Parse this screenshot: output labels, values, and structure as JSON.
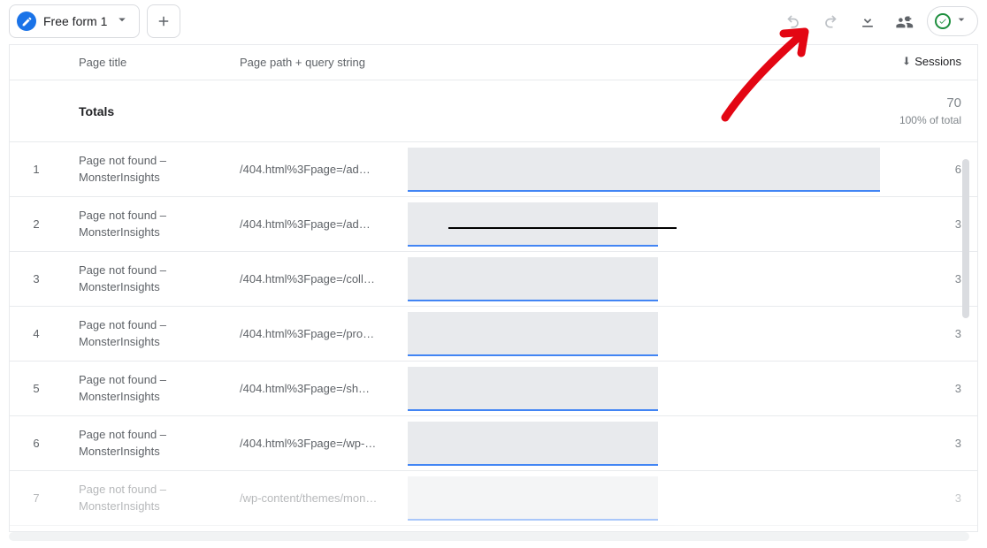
{
  "toolbar": {
    "tab_label": "Free form 1"
  },
  "columns": {
    "page_title": "Page title",
    "page_path": "Page path + query string",
    "sessions": "Sessions"
  },
  "totals": {
    "label": "Totals",
    "value": "70",
    "sub": "100% of total"
  },
  "rows": [
    {
      "n": "1",
      "title": "Page not found – MonsterInsights",
      "path": "/404.html%3Fpage=/ad…",
      "sessions": "6",
      "bar_pct": 100,
      "fade": false
    },
    {
      "n": "2",
      "title": "Page not found – MonsterInsights",
      "path": "/404.html%3Fpage=/ad…",
      "sessions": "3",
      "bar_pct": 53,
      "fade": false,
      "blackline": true
    },
    {
      "n": "3",
      "title": "Page not found – MonsterInsights",
      "path": "/404.html%3Fpage=/coll…",
      "sessions": "3",
      "bar_pct": 53,
      "fade": false
    },
    {
      "n": "4",
      "title": "Page not found – MonsterInsights",
      "path": "/404.html%3Fpage=/pro…",
      "sessions": "3",
      "bar_pct": 53,
      "fade": false
    },
    {
      "n": "5",
      "title": "Page not found – MonsterInsights",
      "path": "/404.html%3Fpage=/sh…",
      "sessions": "3",
      "bar_pct": 53,
      "fade": false
    },
    {
      "n": "6",
      "title": "Page not found – MonsterInsights",
      "path": "/404.html%3Fpage=/wp-…",
      "sessions": "3",
      "bar_pct": 53,
      "fade": false
    },
    {
      "n": "7",
      "title": "Page not found – MonsterInsights",
      "path": "/wp-content/themes/mon…",
      "sessions": "3",
      "bar_pct": 53,
      "fade": true
    }
  ]
}
